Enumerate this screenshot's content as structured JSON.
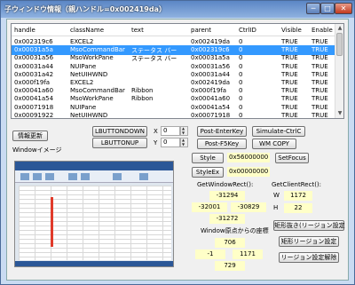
{
  "window": {
    "title": "子ウィンドウ情報（親ハンドル=0x002419da）",
    "min": "─",
    "max": "□",
    "close": "✕"
  },
  "list": {
    "columns": [
      "handle",
      "className",
      "text",
      "parent",
      "CtrlID",
      "Visible",
      "Enable"
    ],
    "rows": [
      [
        "0x002319c6",
        "EXCEL2",
        "",
        "0x002419da",
        "0",
        "TRUE",
        "TRUE"
      ],
      [
        "0x00031a5a",
        "MsoCommandBar",
        "ステータス バー",
        "0x002319c6",
        "0",
        "TRUE",
        "TRUE"
      ],
      [
        "0x00031a56",
        "MsoWorkPane",
        "ステータス バー",
        "0x00031a5a",
        "0",
        "TRUE",
        "TRUE"
      ],
      [
        "0x00031a44",
        "NUIPane",
        "",
        "0x00031a56",
        "0",
        "TRUE",
        "TRUE"
      ],
      [
        "0x00031a42",
        "NetUIHWND",
        "",
        "0x00031a44",
        "0",
        "TRUE",
        "TRUE"
      ],
      [
        "0x000f19fa",
        "EXCEL2",
        "",
        "0x002419da",
        "0",
        "TRUE",
        "TRUE"
      ],
      [
        "0x00041a60",
        "MsoCommandBar",
        "Ribbon",
        "0x000f19fa",
        "0",
        "TRUE",
        "TRUE"
      ],
      [
        "0x00041a54",
        "MsoWorkPane",
        "Ribbon",
        "0x00041a60",
        "0",
        "TRUE",
        "TRUE"
      ],
      [
        "0x00071918",
        "NUIPane",
        "",
        "0x00041a54",
        "0",
        "TRUE",
        "TRUE"
      ],
      [
        "0x00091922",
        "NetUIHWND",
        "",
        "0x00071918",
        "0",
        "TRUE",
        "TRUE"
      ]
    ],
    "selected_row": 1
  },
  "controls": {
    "refresh": "情報更新",
    "lbutton_down": "LBUTTONDOWN",
    "lbutton_up": "LBUTTONUP",
    "x_label": "X",
    "y_label": "Y",
    "x_value": "0",
    "y_value": "0",
    "post_enter": "Post-EnterKey",
    "simulate_ctrlc": "Simulate-CtrlC",
    "post_f5": "Post-F5Key",
    "wm_copy": "WM COPY",
    "window_image_label": "Windowイメージ",
    "style_btn": "Style",
    "style_value": "0x56000000",
    "setfocus": "SetFocus",
    "styleex_btn": "StyleEx",
    "styleex_value": "0x00000000",
    "getwindowrect_label": "GetWindowRect():",
    "getclientrect_label": "GetClientRect():",
    "wr_top": "-31294",
    "wr_left": "-32001",
    "wr_right": "-30829",
    "wr_bottom": "-31272",
    "w_label": "W",
    "h_label": "H",
    "cr_w": "1172",
    "cr_h": "22",
    "origin_label": "Window原点からの座標",
    "o_top": "706",
    "o_left": "-1",
    "o_right": "1171",
    "o_bottom": "729",
    "rect_region_btn": "矩形抜き(リージョン設定",
    "rect_region2_btn": "矩形リージョン設定",
    "region_release_btn": "リージョン設定解除"
  },
  "colors": {
    "selection": "#3399ff",
    "field": "#ffffc8"
  }
}
